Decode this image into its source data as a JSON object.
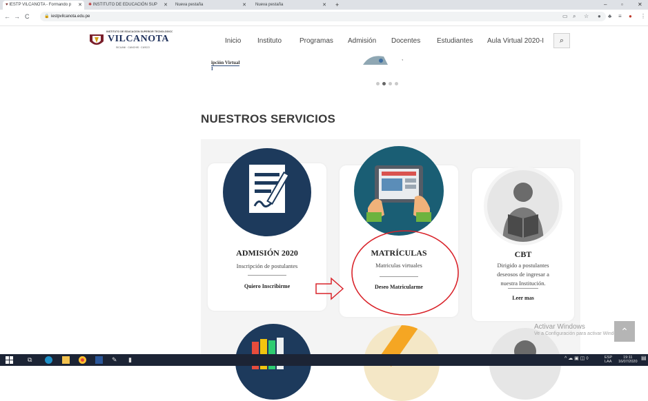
{
  "browser": {
    "tabs": [
      {
        "title": "IESTP VILCANOTA - Formando p",
        "active": true
      },
      {
        "title": "INSTITUTO DE EDUCACIÓN SUP",
        "active": false
      },
      {
        "title": "Nueva pestaña",
        "active": false
      },
      {
        "title": "Nueva pestaña",
        "active": false
      }
    ],
    "new_tab": "+",
    "url": "iestpvilcanota.edu.pe"
  },
  "site": {
    "logo_text": "VILCANOTA",
    "logo_top_small": "INSTITUTO DE EDUCACIÓN SUPERIOR TECNOLÓGICO PÚBLICO",
    "logo_bottom_small": "SICUANI · CANCHIS · CUSCO",
    "nav": [
      "Inicio",
      "Instituto",
      "Programas",
      "Admisión",
      "Docentes",
      "Estudiantes",
      "Aula Virtual 2020-I"
    ],
    "slide_text_line1": "ipción Virtual",
    "slide_text_line2": "I",
    "section_title": "NUESTROS SERVICIOS",
    "cards": [
      {
        "title": "ADMISIÓN 2020",
        "desc": "Inscripción de postulantes",
        "link": "Quiero Inscribirme"
      },
      {
        "title": "MATRÍCULAS",
        "desc": "Matriculas virtuales",
        "link": "Deseo Matricularme"
      },
      {
        "title": "CBT",
        "desc_lines": [
          "Dirigido a postulantes",
          "deseosos de ingresar a",
          "nuestra Institución."
        ],
        "link": "Leer mas"
      }
    ]
  },
  "watermark": {
    "line1": "Activar Windows",
    "line2": "Ve a Configuración para activar Windows."
  },
  "taskbar": {
    "lang_top": "ESP",
    "lang_bottom": "LAA",
    "time": "19:11",
    "date": "16/07/2020"
  },
  "colors": {
    "annotation_red": "#d9232a",
    "icon_navy": "#1d3a5c",
    "icon_teal": "#1a5e74"
  }
}
